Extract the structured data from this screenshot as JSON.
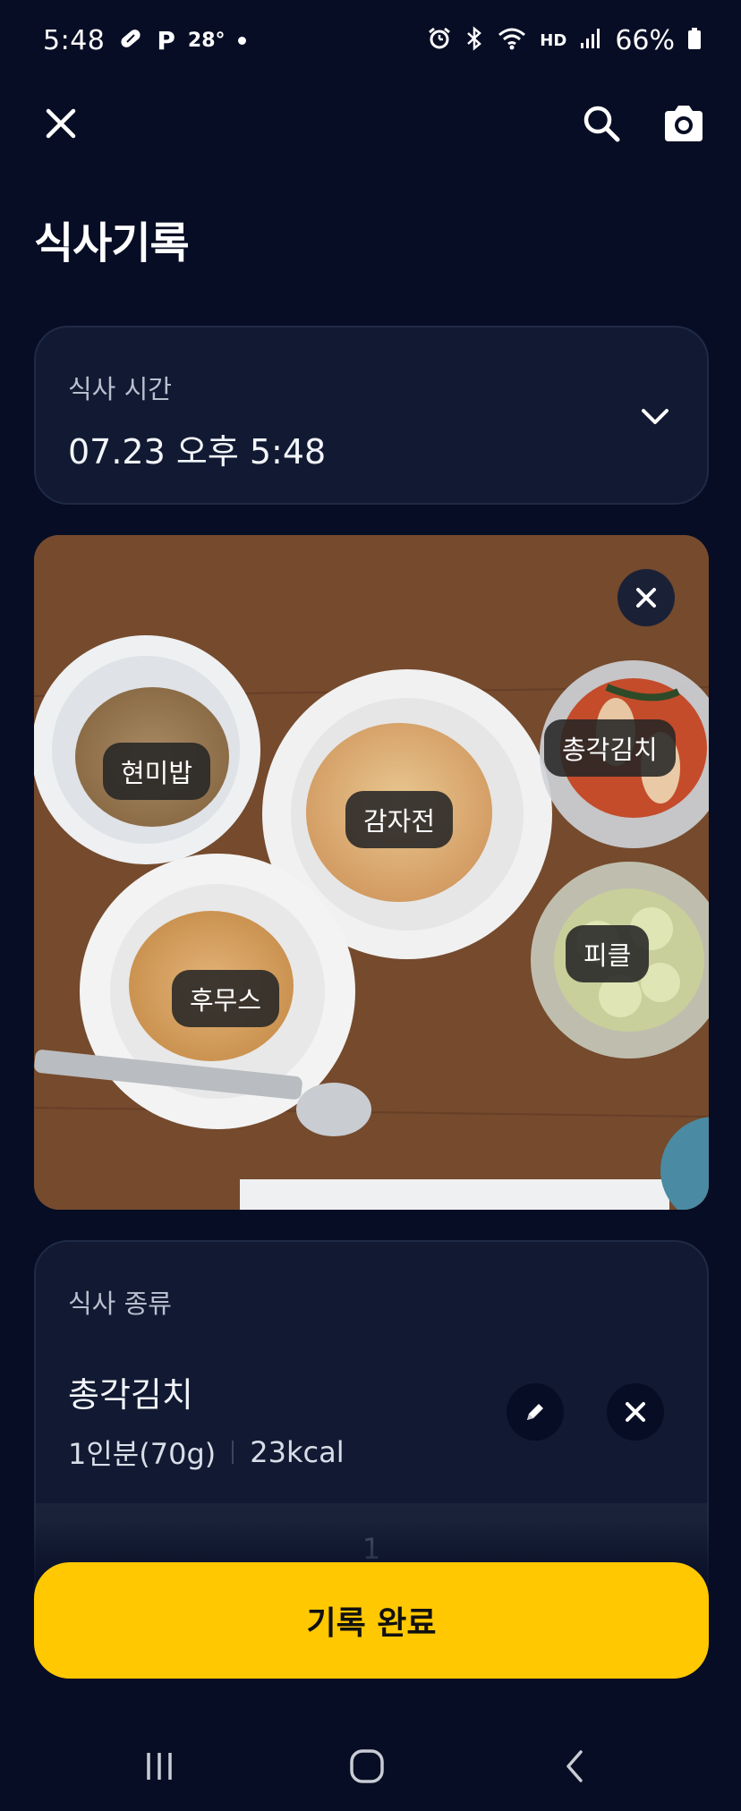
{
  "status_bar": {
    "time": "5:48",
    "parking_label": "P",
    "temperature": "28°",
    "network_label": "HD",
    "battery": "66%",
    "icons": [
      "pill-icon",
      "alarm-icon",
      "bluetooth-icon",
      "wifi-icon",
      "signal-icon",
      "battery-icon"
    ]
  },
  "app_bar": {
    "icons": [
      "close-icon",
      "search-icon",
      "camera-icon"
    ]
  },
  "page": {
    "title": "식사기록"
  },
  "meal_time": {
    "label": "식사 시간",
    "value": "07.23 오후 5:48"
  },
  "photo": {
    "tags": [
      {
        "label": "현미밥"
      },
      {
        "label": "감자전"
      },
      {
        "label": "총각김치"
      },
      {
        "label": "후무스"
      },
      {
        "label": "피클"
      }
    ]
  },
  "meal_type": {
    "label": "식사 종류",
    "item": {
      "name": "총각김치",
      "serving": "1인분(70g)",
      "calories": "23kcal",
      "quantity": "1"
    }
  },
  "cta": {
    "label": "기록 완료",
    "color": "#ffc800"
  },
  "theme": {
    "background": "#070d24",
    "card": "#111a32"
  }
}
